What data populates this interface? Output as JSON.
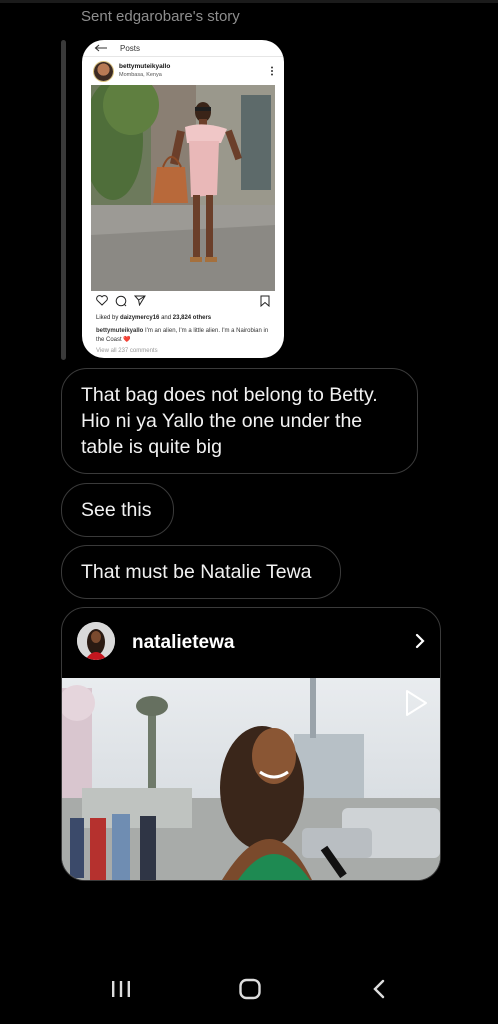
{
  "story_share": {
    "caption": "Sent edgarobare's story",
    "post_card": {
      "nav_back_label": "Posts",
      "username": "bettymuteikyallo",
      "location": "Mombasa, Kenya",
      "liked_by_prefix": "Liked by",
      "liked_by_user": "daizymercy16",
      "liked_by_and": "and",
      "liked_by_count": "23,824 others",
      "caption_user": "bettymuteikyallo",
      "caption_text": "I'm an alien, I'm a little alien. I'm a Nairobian in the Coast",
      "heart_emoji": "❤️",
      "view_comments": "View all 237 comments"
    }
  },
  "messages": [
    {
      "text_line1": "That bag does not belong to Betty.",
      "text_line2": "Hio ni ya Yallo the one under the",
      "text_line3": "table is quite big"
    },
    {
      "text": "See this"
    },
    {
      "text": "That must be Natalie Tewa"
    }
  ],
  "shared_post": {
    "username": "natalietewa"
  },
  "colors": {
    "background": "#000000",
    "bubble_border": "#3a3a3a",
    "caption_gray": "#8e8e8e"
  },
  "icons": [
    "back-arrow-icon",
    "more-vertical-icon",
    "heart-icon",
    "comment-icon",
    "send-icon",
    "bookmark-icon",
    "chevron-right-icon",
    "play-icon",
    "recents-icon",
    "home-icon",
    "back-icon"
  ]
}
